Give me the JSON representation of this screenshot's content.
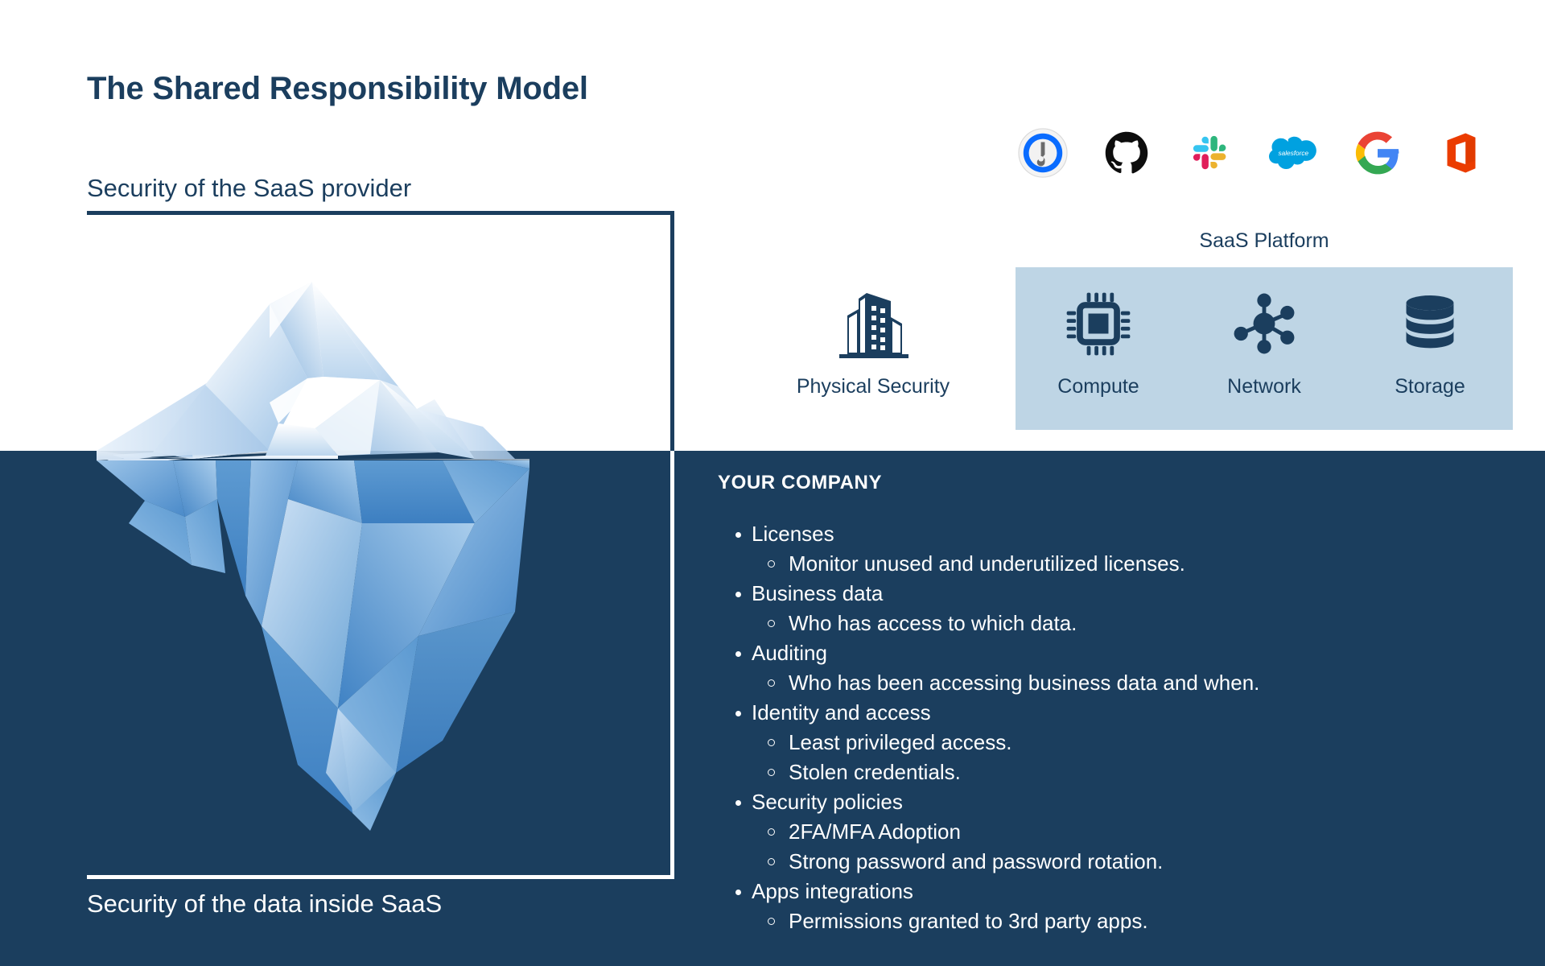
{
  "page": {
    "title": "The Shared Responsibility Model",
    "subtitle_top": "Security of the SaaS provider",
    "subtitle_bottom": "Security of the data inside SaaS"
  },
  "colors": {
    "navy": "#1b3e5e",
    "panel_blue": "#bed5e5",
    "white": "#ffffff",
    "ice_light": "#d8e7f5",
    "ice_mid": "#8fb9e0",
    "ice_deep": "#3f82c4"
  },
  "logos": [
    {
      "name": "1password-logo",
      "label": "1Password"
    },
    {
      "name": "github-logo",
      "label": "GitHub"
    },
    {
      "name": "slack-logo",
      "label": "Slack"
    },
    {
      "name": "salesforce-logo",
      "label": "Salesforce"
    },
    {
      "name": "google-logo",
      "label": "Google"
    },
    {
      "name": "microsoft-office-logo",
      "label": "Microsoft Office"
    }
  ],
  "provider": {
    "saas_platform_label": "SaaS Platform",
    "physical_security_label": "Physical Security",
    "physical_security_icon": "office-building-icon",
    "infrastructure": [
      {
        "label": "Compute",
        "icon": "cpu-chip-icon"
      },
      {
        "label": "Network",
        "icon": "network-nodes-icon"
      },
      {
        "label": "Storage",
        "icon": "database-stack-icon"
      }
    ]
  },
  "company": {
    "heading": "YOUR COMPANY",
    "items": [
      {
        "label": "Licenses",
        "subitems": [
          "Monitor unused and underutilized licenses."
        ]
      },
      {
        "label": "Business data",
        "subitems": [
          "Who has access to which data."
        ]
      },
      {
        "label": "Auditing",
        "subitems": [
          "Who has been accessing business data and when."
        ]
      },
      {
        "label": "Identity and access",
        "subitems": [
          "Least privileged access.",
          "Stolen credentials."
        ]
      },
      {
        "label": "Security policies",
        "subitems": [
          "2FA/MFA Adoption",
          "Strong password and password rotation."
        ]
      },
      {
        "label": "Apps integrations",
        "subitems": [
          "Permissions granted to 3rd party apps."
        ]
      }
    ]
  }
}
